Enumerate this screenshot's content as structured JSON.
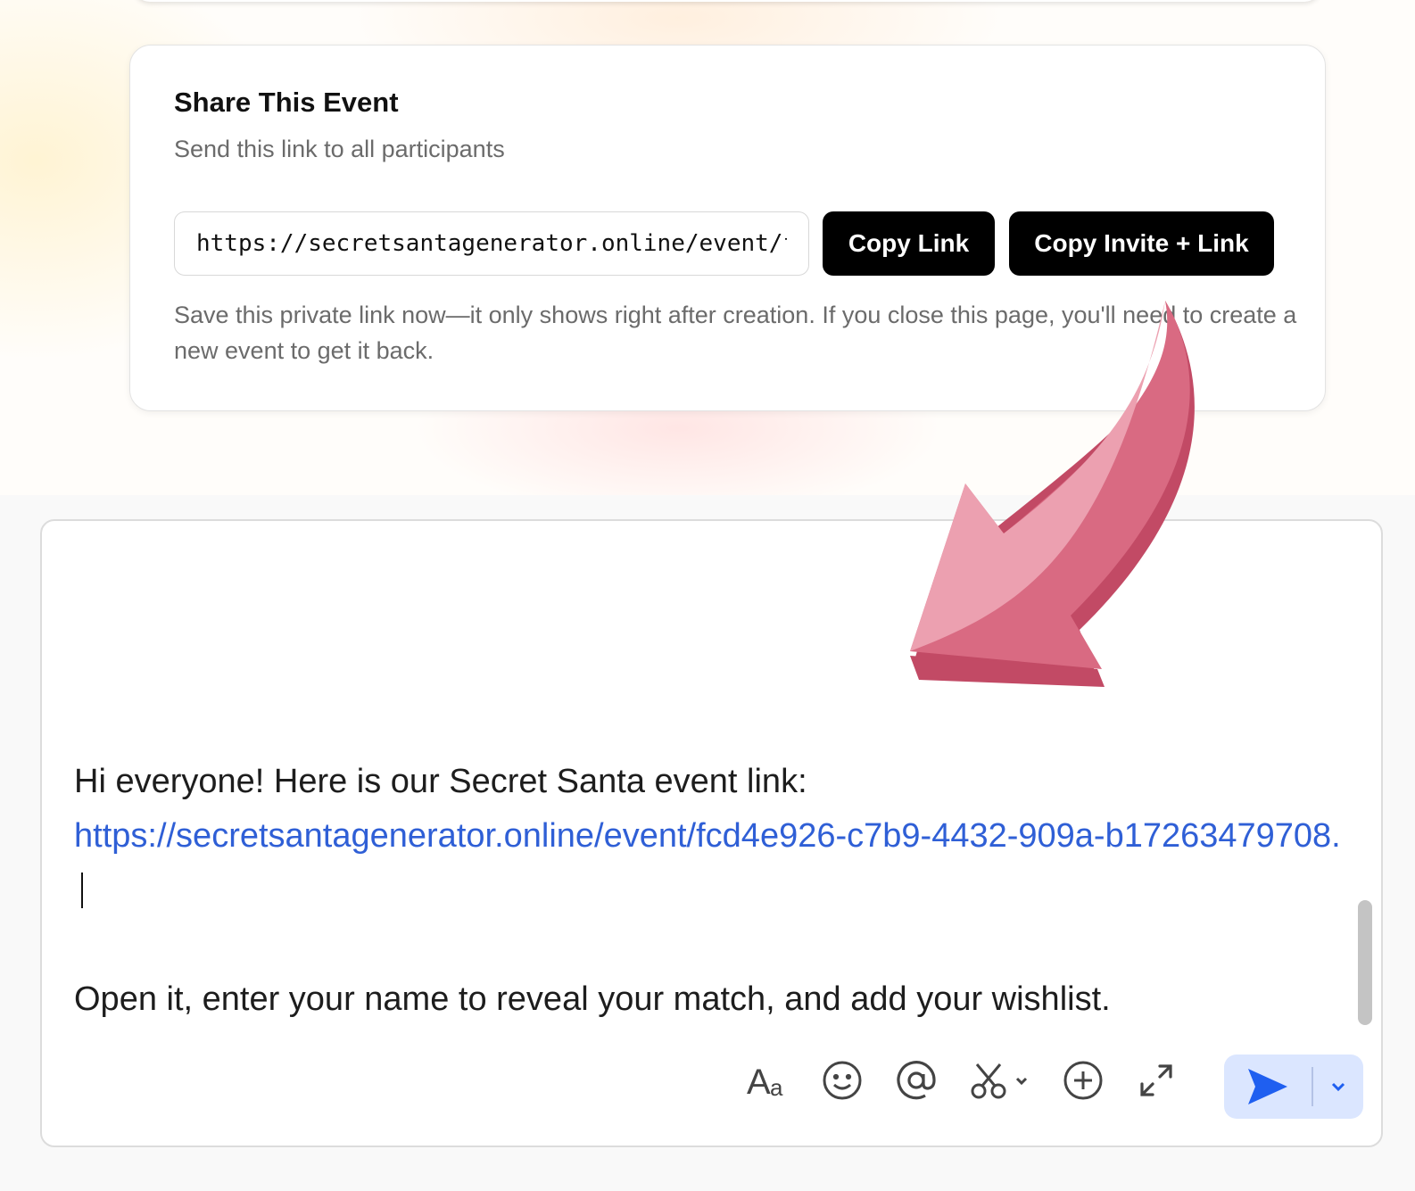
{
  "share": {
    "title": "Share This Event",
    "subtitle": "Send this link to all participants",
    "link_value": "https://secretsantagenerator.online/event/fcd4e926-c7b9-4432-909a-b17263479708",
    "copy_link_label": "Copy Link",
    "copy_invite_label": "Copy Invite + Link",
    "note": "Save this private link now—it only shows right after creation. If you close this page, you'll need to create a new event to get it back."
  },
  "compose": {
    "greeting": "Hi everyone! Here is our Secret Santa event link:",
    "link_text": "https://secretsantagenerator.online/event/fcd4e926-c7b9-4432-909a-b17263479708.",
    "body": "Open it, enter your name to reveal your match, and add your wishlist.",
    "toolbar_icons": [
      "text-format-icon",
      "emoji-icon",
      "mention-icon",
      "scissors-icon",
      "plus-circle-icon",
      "expand-icon"
    ],
    "send_icon": "send-icon"
  },
  "colors": {
    "button_bg": "#000000",
    "link": "#2f5fd6",
    "send_bg": "#dbe6ff",
    "send_icon": "#1f5ff0",
    "annotation_arrow": "#d96a82"
  }
}
